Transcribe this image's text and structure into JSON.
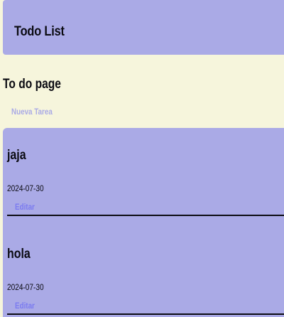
{
  "header": {
    "title": "Todo List"
  },
  "page": {
    "title": "To do page",
    "new_task_label": "Nueva Tarea"
  },
  "tasks": [
    {
      "title": "jaja",
      "date": "2024-07-30",
      "edit_label": "Editar"
    },
    {
      "title": "hola",
      "date": "2024-07-30",
      "edit_label": "Editar"
    }
  ],
  "colors": {
    "background": "#f6f5dc",
    "panel": "#aaaae6",
    "link": "#7b7bf0",
    "text": "#0b0b12"
  }
}
